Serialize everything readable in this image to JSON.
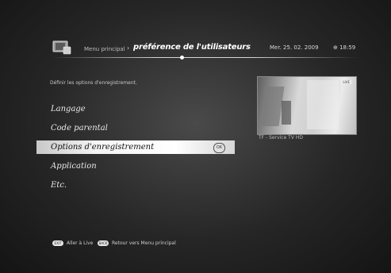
{
  "header": {
    "breadcrumb_root": "Menu principal",
    "breadcrumb_sep": "›",
    "title": "préférence de l'utilisateurs",
    "date": "Mer. 25. 02. 2009",
    "time": "⊕ 18:59"
  },
  "main": {
    "instruction": "Définir les options d'enregistrement.",
    "menu_items": [
      {
        "label": "Langage",
        "selected": false
      },
      {
        "label": "Code parental",
        "selected": false
      },
      {
        "label": "Options d'enregistrement",
        "selected": true
      },
      {
        "label": "Application",
        "selected": false
      },
      {
        "label": "Etc.",
        "selected": false
      }
    ],
    "ok_label": "OK"
  },
  "preview": {
    "badge": "LIVE",
    "channel": "TF - Service TV HD"
  },
  "footer": {
    "exit_key": "EXIT",
    "exit_label": "Aller à Live",
    "back_key": "BACK",
    "back_label": "Retour vers Menu principal"
  }
}
